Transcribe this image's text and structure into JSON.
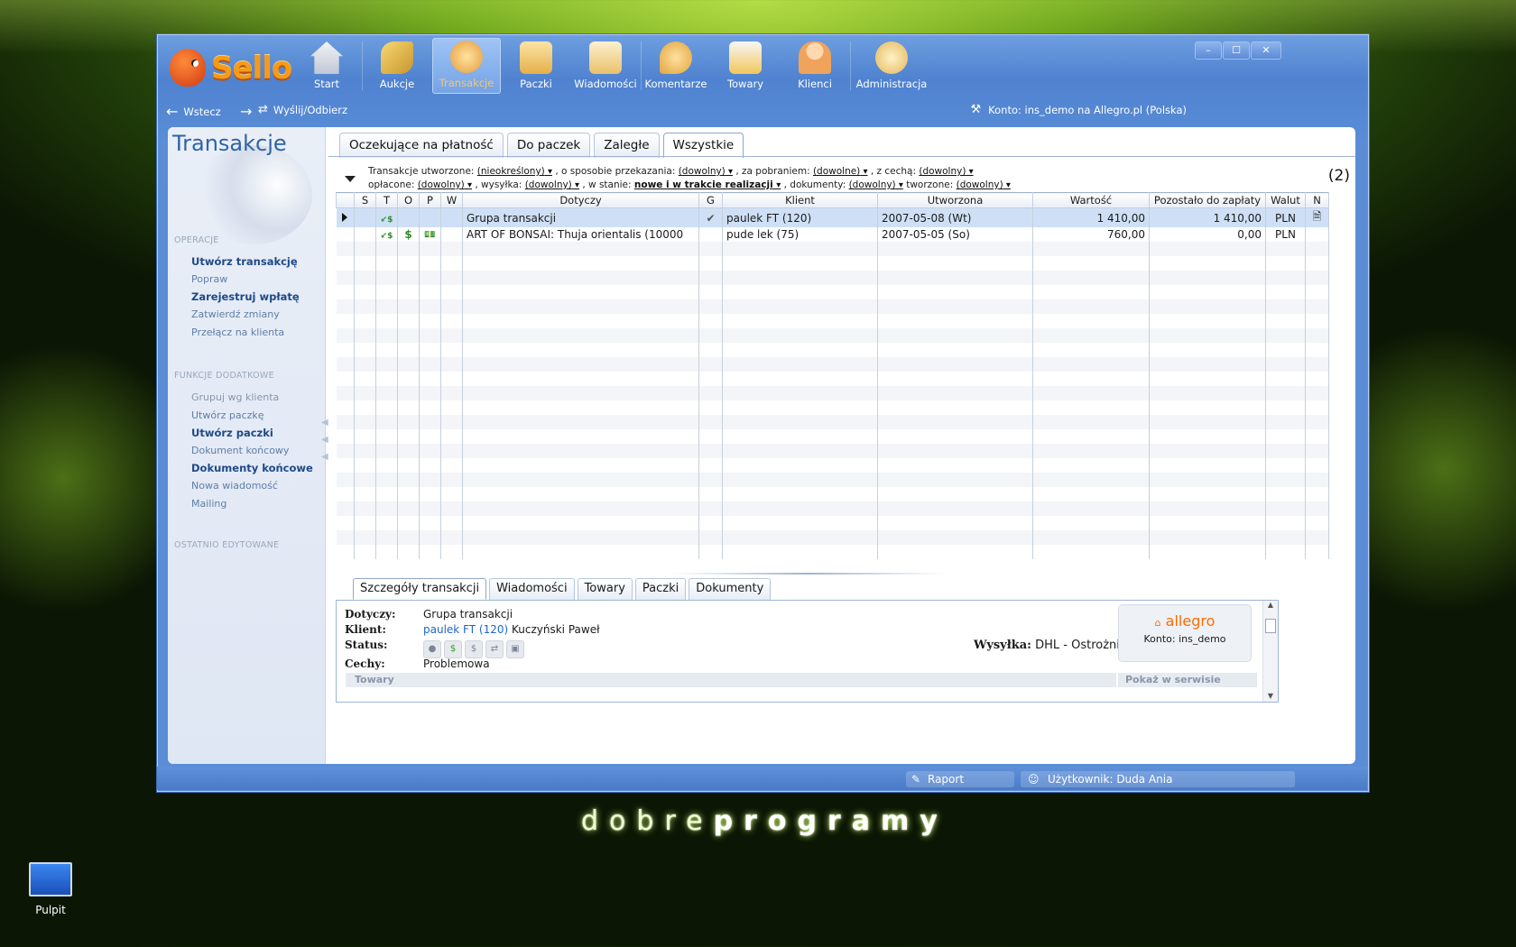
{
  "app": {
    "brand": "Sello",
    "window_controls": [
      "–",
      "☐",
      "✕"
    ]
  },
  "toolbar": [
    {
      "label": "Start",
      "icon": "house-icon"
    },
    {
      "label": "Aukcje",
      "icon": "gavel-icon"
    },
    {
      "label": "Transakcje",
      "icon": "handshake-icon",
      "active": true
    },
    {
      "label": "Paczki",
      "icon": "package-icon"
    },
    {
      "label": "Wiadomości",
      "icon": "envelope-icon"
    },
    {
      "label": "Komentarze",
      "icon": "comment-icon"
    },
    {
      "label": "Towary",
      "icon": "boxes-icon"
    },
    {
      "label": "Klienci",
      "icon": "person-icon"
    },
    {
      "label": "Administracja",
      "icon": "gears-icon"
    }
  ],
  "nav": {
    "back": "Wstecz",
    "sync": "Wyślij/Odbierz",
    "account": "Konto: ins_demo na Allegro.pl (Polska)"
  },
  "sidebar": {
    "title": "Transakcje",
    "section_ops": "OPERACJE",
    "ops": [
      "Utwórz transakcję",
      "Popraw",
      "Zarejestruj wpłatę",
      "Zatwierdź zmiany",
      "Przełącz na klienta"
    ],
    "section_extra": "FUNKCJE DODATKOWE",
    "extra": [
      "Grupuj wg klienta",
      "Utwórz paczkę",
      "Utwórz paczki",
      "Dokument końcowy",
      "Dokumenty końcowe",
      "Nowa wiadomość",
      "Mailing"
    ],
    "section_recent": "OSTATNIO EDYTOWANE"
  },
  "tabs": [
    "Oczekujące na płatność",
    "Do paczek",
    "Zaległe",
    "Wszystkie"
  ],
  "filters": {
    "created_label": "Transakcje utworzone:",
    "created_val": "(nieokreślony)",
    "method_label": ", o sposobie przekazania:",
    "method_val": "(dowolny)",
    "cod_label": ", za pobraniem:",
    "cod_val": "(dowolne)",
    "feature_label": ", z cechą:",
    "feature_val": "(dowolny)",
    "paid_label": "opłacone:",
    "paid_val": "(dowolny)",
    "ship_label": ", wysyłka:",
    "ship_val": "(dowolny)",
    "state_label": ", w stanie:",
    "state_val": "nowe i w trakcie realizacji",
    "docs_label": ", dokumenty:",
    "docs_val": "(dowolny)",
    "createdby_label": "tworzone:",
    "createdby_val": "(dowolny)"
  },
  "count": "(2)",
  "grid": {
    "columns": [
      "",
      "S",
      "T",
      "O",
      "P",
      "W",
      "Dotyczy",
      "G",
      "Klient",
      "Utworzona",
      "Wartość",
      "Pozostało do zapłaty",
      "Walut",
      "N"
    ],
    "rows": [
      {
        "dotyczy": "Grupa transakcji",
        "g": "✔",
        "klient": "paulek FT (120)",
        "utworzona": "2007-05-08 (Wt)",
        "wartosc": "1 410,00",
        "pozostalo": "1 410,00",
        "waluta": "PLN",
        "o": "",
        "p": ""
      },
      {
        "dotyczy": "ART OF BONSAI: Thuja orientalis (10000",
        "g": "",
        "klient": "pude lek (75)",
        "utworzona": "2007-05-05 (So)",
        "wartosc": "760,00",
        "pozostalo": "0,00",
        "waluta": "PLN",
        "o": "$",
        "p": "💵"
      }
    ]
  },
  "detail_tabs": [
    "Szczegóły transakcji",
    "Wiadomości",
    "Towary",
    "Paczki",
    "Dokumenty"
  ],
  "details": {
    "dotyczy_label": "Dotyczy:",
    "dotyczy": "Grupa transakcji",
    "klient_label": "Klient:",
    "klient_link": "paulek FT (120)",
    "klient_name": "Kuczyński Paweł",
    "status_label": "Status:",
    "cechy_label": "Cechy:",
    "cechy": "Problemowa",
    "wysylka_label": "Wysyłka:",
    "wysylka": "DHL - Ostrożnie",
    "allegro": "allegro",
    "konto": "Konto: ins_demo",
    "towary": "Towary",
    "pokaz": "Pokaż w serwisie"
  },
  "status": {
    "raport": "Raport",
    "user": "Użytkownik: Duda Ania"
  },
  "desktop": {
    "brand_light": "dobre",
    "brand_heavy": "programy",
    "icon_label": "Pulpit"
  }
}
